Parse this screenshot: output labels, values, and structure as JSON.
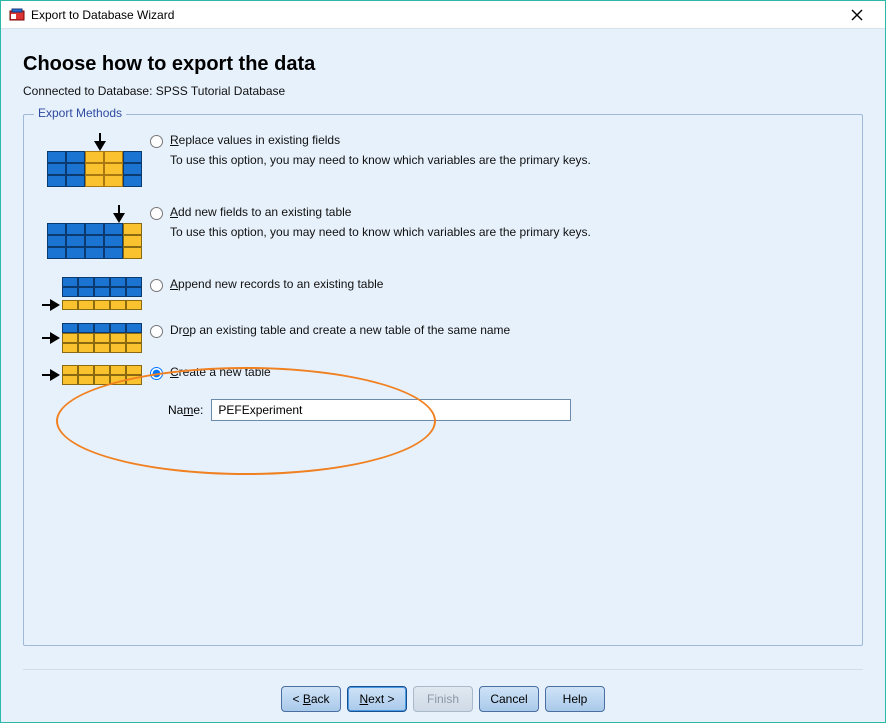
{
  "window": {
    "title": "Export to Database Wizard"
  },
  "page": {
    "heading": "Choose how to export the data",
    "connected_prefix": "Connected to Database:  ",
    "connected_db": "SPSS Tutorial Database"
  },
  "fieldset": {
    "legend": "Export Methods"
  },
  "options": {
    "replace": {
      "label_pre": "",
      "label_u": "R",
      "label_post": "eplace values in existing fields",
      "hint": "To use this option, you may need to know which variables are the primary keys."
    },
    "addfields": {
      "label_pre": "",
      "label_u": "A",
      "label_post": "dd new fields to an existing table",
      "hint": "To use this option, you may need to know which variables are the primary keys."
    },
    "append": {
      "label_pre": "",
      "label_u": "A",
      "label_post": "ppend new records to an existing table"
    },
    "drop": {
      "label_pre": "Dr",
      "label_u": "o",
      "label_post": "p an existing table and create a new table of the same name"
    },
    "create": {
      "label_pre": "",
      "label_u": "C",
      "label_post": "reate a new table"
    },
    "selected": "create"
  },
  "name_field": {
    "label": "Name:",
    "value": "PEFExperiment"
  },
  "footer": {
    "back_pre": "< ",
    "back_u": "B",
    "back_post": "ack",
    "next_u": "N",
    "next_post": "ext >",
    "finish": "Finish",
    "cancel": "Cancel",
    "help": "Help"
  }
}
